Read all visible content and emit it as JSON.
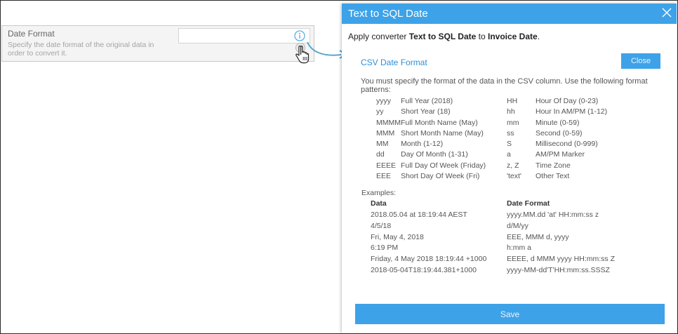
{
  "form": {
    "label": "Date Format",
    "help": "Specify the date format of the original data in order to convert it.",
    "value": ""
  },
  "dialog": {
    "title": "Text to SQL Date",
    "apply_prefix": "Apply converter",
    "converter": "Text to SQL Date",
    "apply_mid": "to",
    "field": "Invoice Date",
    "apply_suffix": ".",
    "section_title": "CSV Date Format",
    "close_label": "Close",
    "intro": "You must specify the format of the data in the CSV column. Use the following format patterns:",
    "patterns_left": [
      {
        "code": "yyyy",
        "desc": "Full Year (2018)"
      },
      {
        "code": "yy",
        "desc": "Short Year (18)"
      },
      {
        "code": "MMMM",
        "desc": "Full Month Name (May)"
      },
      {
        "code": "MMM",
        "desc": "Short Month Name (May)"
      },
      {
        "code": "MM",
        "desc": "Month (1-12)"
      },
      {
        "code": "dd",
        "desc": "Day Of Month (1-31)"
      },
      {
        "code": "EEEE",
        "desc": "Full Day Of Week (Friday)"
      },
      {
        "code": "EEE",
        "desc": "Short Day Of Week (Fri)"
      }
    ],
    "patterns_right": [
      {
        "code": "HH",
        "desc": "Hour Of Day (0-23)"
      },
      {
        "code": "hh",
        "desc": "Hour In AM/PM (1-12)"
      },
      {
        "code": "mm",
        "desc": "Minute (0-59)"
      },
      {
        "code": "ss",
        "desc": "Second (0-59)"
      },
      {
        "code": "S",
        "desc": "Millisecond (0-999)"
      },
      {
        "code": "a",
        "desc": "AM/PM Marker"
      },
      {
        "code": "z, Z",
        "desc": "Time Zone"
      },
      {
        "code": "'text'",
        "desc": "Other Text"
      }
    ],
    "examples_label": "Examples:",
    "examples_headers": {
      "data": "Data",
      "format": "Date Format"
    },
    "examples": [
      {
        "data": "2018.05.04 at 18:19:44 AEST",
        "format": "yyyy.MM.dd 'at' HH:mm:ss z"
      },
      {
        "data": "4/5/18",
        "format": "d/M/yy"
      },
      {
        "data": "Fri, May 4, 2018",
        "format": "EEE, MMM d, yyyy"
      },
      {
        "data": "6:19 PM",
        "format": "h:mm a"
      },
      {
        "data": "Friday, 4 May 2018 18:19:44 +1000",
        "format": "EEEE, d MMM yyyy HH:mm:ss Z"
      },
      {
        "data": "2018-05-04T18:19:44.381+1000",
        "format": "yyyy-MM-dd'T'HH:mm:ss.SSSZ"
      }
    ],
    "save_label": "Save"
  },
  "colors": {
    "accent": "#3ea2e8",
    "link": "#2c8fd6",
    "arrow": "#5aa6c9"
  },
  "icons": {
    "info": "info-icon",
    "pointer": "hand-pointer-icon",
    "close": "close-icon"
  }
}
